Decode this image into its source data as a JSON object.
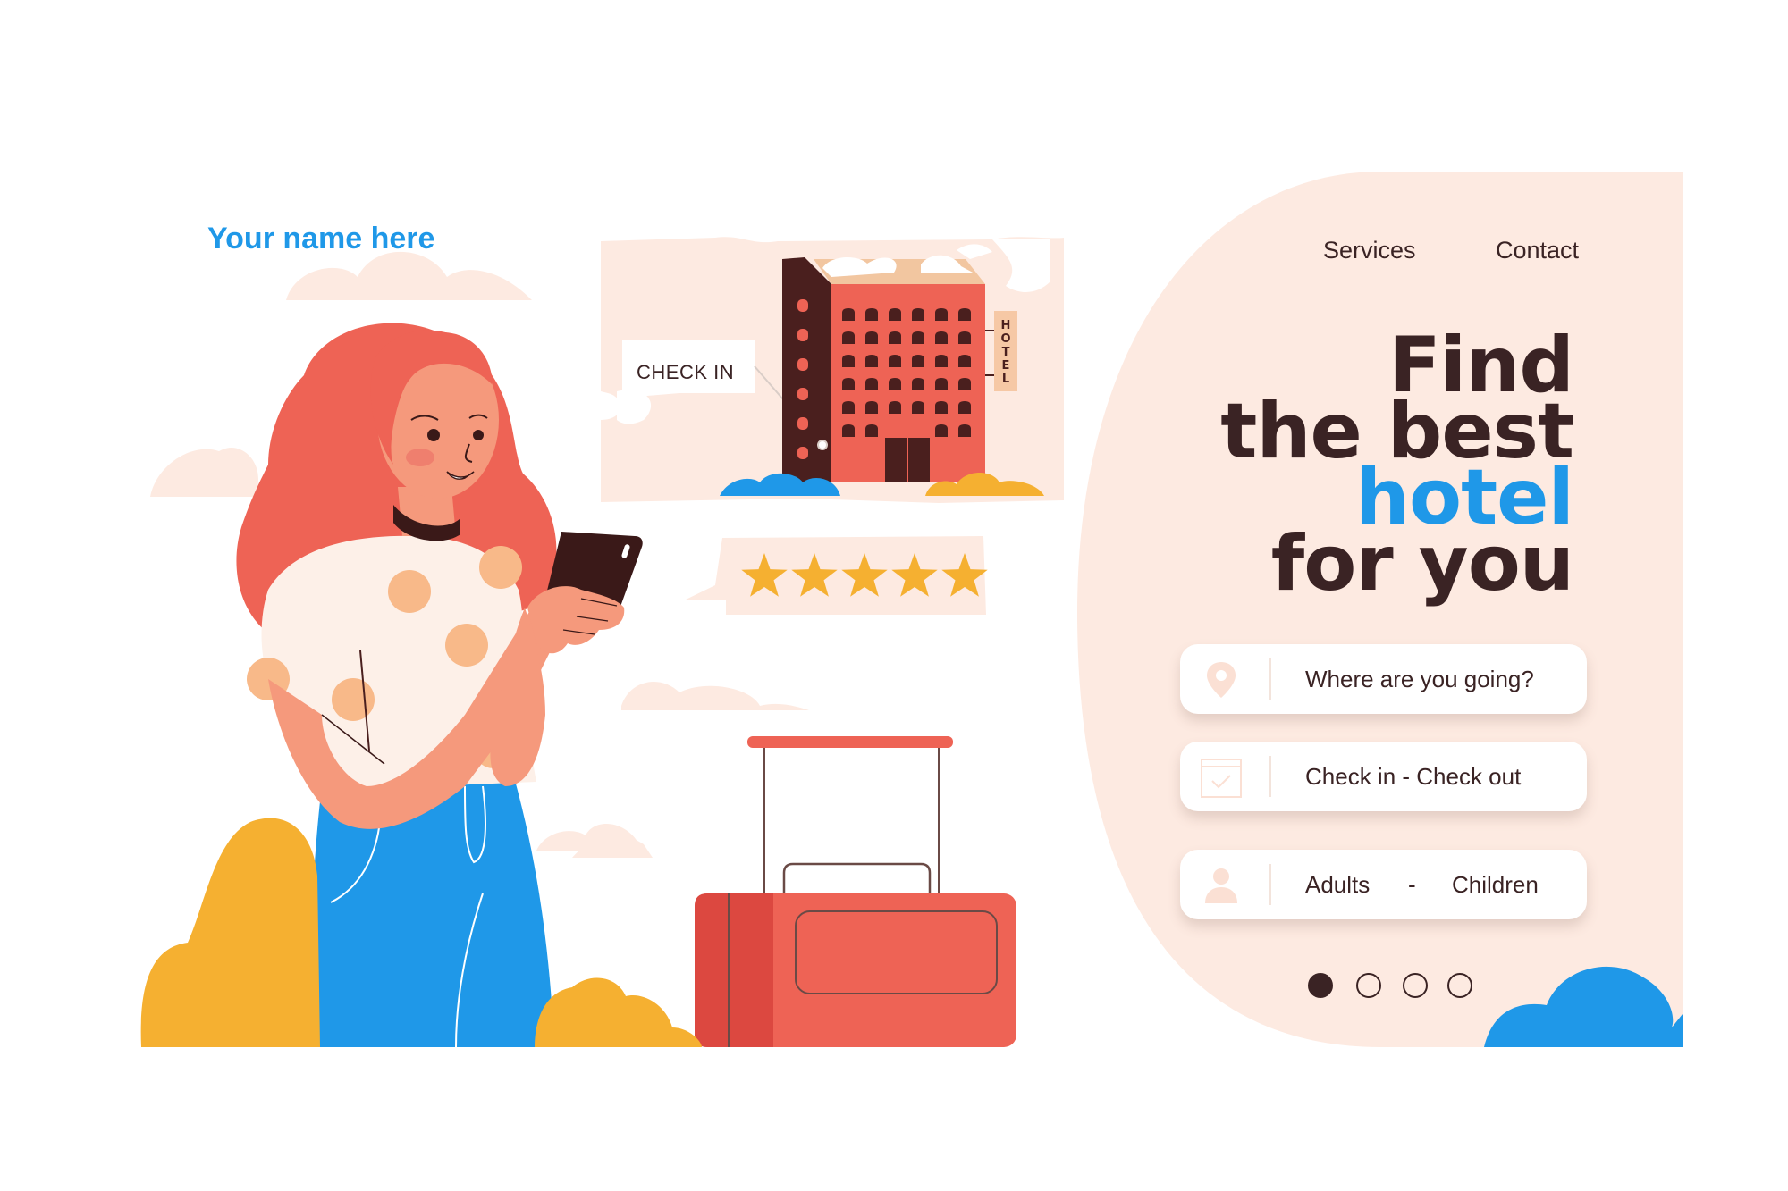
{
  "brand": {
    "text": "Your name here"
  },
  "nav": {
    "items": [
      "Services",
      "Contact"
    ]
  },
  "hero": {
    "line1": "Find",
    "line2": "the best",
    "line3": "hotel",
    "line4": "for you"
  },
  "search": {
    "destination": {
      "placeholder": "Where are you going?",
      "icon": "location-pin-icon"
    },
    "dates": {
      "placeholder": "Check in - Check out",
      "icon": "calendar-icon"
    },
    "guests": {
      "adults_label": "Adults",
      "separator": "-",
      "children_label": "Children",
      "icon": "person-icon"
    }
  },
  "illustration": {
    "checkin_label": "CHECK IN",
    "hotel_sign": [
      "H",
      "O",
      "T",
      "E",
      "L"
    ],
    "rating_stars": 5
  },
  "pagination": {
    "total": 4,
    "active": 1
  },
  "colors": {
    "accent_blue": "#1f98e8",
    "dark_text": "#3a2324",
    "panel_bg": "#fdeae1",
    "coral": "#ee6355",
    "star": "#f5b031"
  }
}
